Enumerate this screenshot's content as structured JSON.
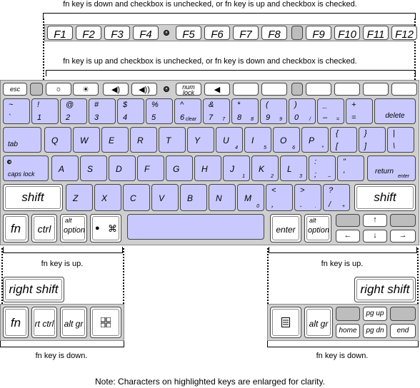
{
  "captions": {
    "top_fn": "fn key is down and checkbox is unchecked, or fn key is up and checkbox is checked.",
    "mid_fn": "fn key is up and checkbox is unchecked, or fn key is down and checkbox is checked.",
    "fn_up_left": "fn key is up.",
    "fn_up_right": "fn key is up.",
    "fn_down_left": "fn key is down.",
    "fn_down_right": "fn key is down.",
    "note": "Note: Characters on highlighted keys are enlarged for clarity."
  },
  "f_keys": [
    "F1",
    "F2",
    "F3",
    "F4",
    "F5",
    "F6",
    "F7",
    "F8",
    "F9",
    "F10",
    "F11",
    "F12"
  ],
  "keyboard": {
    "esc": "esc",
    "num_lock": [
      "num",
      "lock"
    ],
    "row1": [
      {
        "t": "~",
        "b": "`"
      },
      {
        "t": "!",
        "b": "1"
      },
      {
        "t": "@",
        "b": "2"
      },
      {
        "t": "#",
        "b": "3"
      },
      {
        "t": "$",
        "b": "4"
      },
      {
        "t": "%",
        "b": "5"
      },
      {
        "t": "^",
        "b": "6",
        "s": "clear"
      },
      {
        "t": "&",
        "b": "7",
        "s": "7"
      },
      {
        "t": "*",
        "b": "8",
        "s": "8"
      },
      {
        "t": "(",
        "b": "9",
        "s": "9"
      },
      {
        "t": ")",
        "b": "0",
        "s": "/"
      },
      {
        "t": "_",
        "b": "–",
        "s": "="
      },
      {
        "t": "+",
        "b": "="
      }
    ],
    "delete": "delete",
    "tab": "tab",
    "row2": [
      {
        "b": "Q"
      },
      {
        "b": "W"
      },
      {
        "b": "E"
      },
      {
        "b": "R"
      },
      {
        "b": "T"
      },
      {
        "b": "Y"
      },
      {
        "b": "U",
        "s": "4"
      },
      {
        "b": "I",
        "s": "5"
      },
      {
        "b": "O",
        "s": "6"
      },
      {
        "b": "P",
        "s": "*"
      },
      {
        "t": "{",
        "b": "["
      },
      {
        "t": "}",
        "b": "]"
      },
      {
        "t": "|",
        "b": "\\"
      }
    ],
    "caps_lock": "caps lock",
    "row3": [
      {
        "b": "A"
      },
      {
        "b": "S"
      },
      {
        "b": "D"
      },
      {
        "b": "F"
      },
      {
        "b": "G"
      },
      {
        "b": "H"
      },
      {
        "b": "J",
        "s": "1"
      },
      {
        "b": "K",
        "s": "2"
      },
      {
        "b": "L",
        "s": "3"
      },
      {
        "t": ":",
        "b": ";",
        "s": "–"
      },
      {
        "t": "\"",
        "b": "'"
      }
    ],
    "return": "return",
    "enter_sub": "enter",
    "shift": "shift",
    "row4": [
      {
        "b": "Z"
      },
      {
        "b": "X"
      },
      {
        "b": "C"
      },
      {
        "b": "V"
      },
      {
        "b": "B"
      },
      {
        "b": "N"
      },
      {
        "b": "M",
        "s": "0"
      },
      {
        "t": "<",
        "b": ","
      },
      {
        "t": ">",
        "b": ".",
        "s": "."
      },
      {
        "t": "?",
        "b": "/",
        "s": "+"
      }
    ],
    "fn": "fn",
    "ctrl": "ctrl",
    "alt": "alt",
    "option": "option",
    "command": "⌘",
    "enter": "enter",
    "arrows": {
      "up": "↑",
      "left": "←",
      "down": "↓",
      "right": "→"
    }
  },
  "fn_down_keys": {
    "right_shift": "right shift",
    "fn": "fn",
    "rt_ctrl": "rt ctrl",
    "alt_gr_left": "alt gr",
    "alt_gr_right": "alt gr",
    "pg_up": "pg up",
    "home": "home",
    "pg_dn": "pg dn",
    "end": "end"
  }
}
